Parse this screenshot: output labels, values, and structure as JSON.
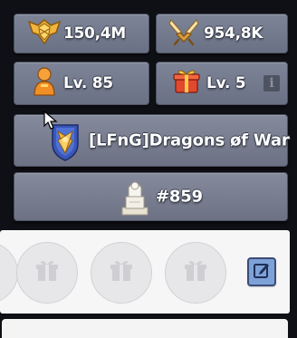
{
  "stats": {
    "power": {
      "value": "150,4M",
      "icon": "shield-wings-icon"
    },
    "kills": {
      "value": "954,8K",
      "icon": "crossed-swords-icon"
    },
    "level": {
      "value": "Lv. 85",
      "icon": "commander-icon"
    },
    "gift_level": {
      "value": "Lv. 5",
      "icon": "gift-box-icon"
    }
  },
  "alliance": {
    "name": "[LFnG]Dragons øf War",
    "icon": "alliance-emblem-icon"
  },
  "rank": {
    "value": "#859",
    "icon": "statue-icon"
  },
  "info_button": {
    "label": "i"
  },
  "gift_slots": [
    {
      "icon": "gift-icon"
    },
    {
      "icon": "gift-icon"
    },
    {
      "icon": "gift-icon"
    },
    {
      "icon": "gift-icon"
    }
  ],
  "colors": {
    "panel_bg": "#6c7284",
    "text": "#ffffff",
    "edit_button": "#7ea1d8"
  }
}
